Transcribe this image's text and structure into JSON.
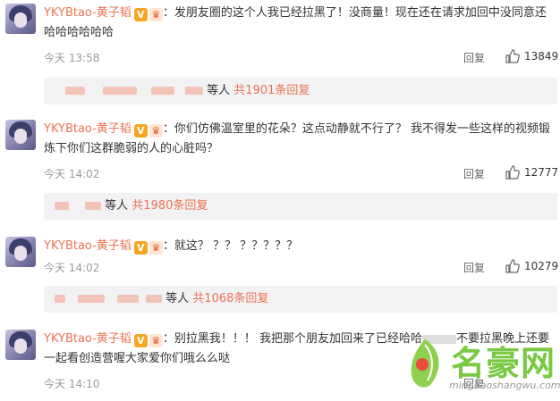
{
  "comments": [
    {
      "username": "YKYBtao-黄子韬",
      "text": "：发朋友圈的这个人我已经拉黑了！没商量！现在还在请求加回中没同意还哈哈哈哈哈哈",
      "time": "今天 13:58",
      "reply_label": "回复",
      "likes": "13849",
      "sub_suffix": "等人",
      "sub_count": "共1901条回复"
    },
    {
      "username": "YKYBtao-黄子韬",
      "text": "：你们仿佛温室里的花朵？这点动静就不行了？ 我不得发一些这样的视频锻炼下你们这群脆弱的人的心脏吗？",
      "time": "今天 14:02",
      "reply_label": "回复",
      "likes": "12777",
      "sub_suffix": "等人",
      "sub_count": "共1980条回复"
    },
    {
      "username": "YKYBtao-黄子韬",
      "text": "：就这？ ？？ ？？？？？",
      "time": "今天 14:02",
      "reply_label": "回复",
      "likes": "10279",
      "sub_suffix": "等人",
      "sub_count": "共1068条回复"
    },
    {
      "username": "YKYBtao-黄子韬",
      "text_a": "：别拉黑我！！！ 我把那个朋友加回来了已经哈哈",
      "text_b": "不要拉黑晚上还要一起看创造营喔大家爱你们哦么么哒",
      "time": "今天 14:10",
      "reply_label": "回复"
    }
  ],
  "badges": {
    "verified": "V",
    "crown": "♛"
  },
  "watermark": {
    "title": "名豪网",
    "url": "minghaoshangwu.com"
  },
  "colors": {
    "username": "#eb7350",
    "accent_count": "#eb7350",
    "watermark": "#7ac943"
  }
}
